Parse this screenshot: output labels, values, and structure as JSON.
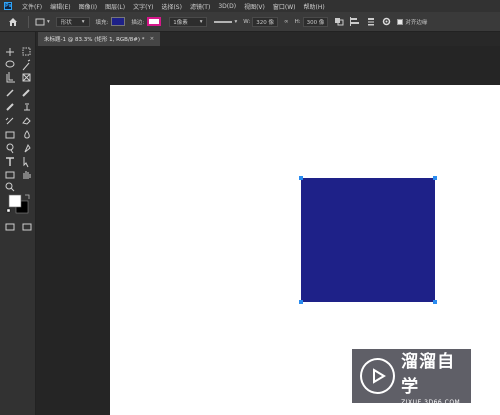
{
  "app": {
    "logo": "Ps"
  },
  "menu": [
    "文件(F)",
    "编辑(E)",
    "图像(I)",
    "图层(L)",
    "文字(Y)",
    "选择(S)",
    "滤镜(T)",
    "3D(D)",
    "视图(V)",
    "窗口(W)",
    "帮助(H)"
  ],
  "options": {
    "mode": "形状",
    "fill_label": "填充:",
    "stroke_label": "描边:",
    "stroke_width": "1像素",
    "w_label": "W:",
    "w_value": "320 像",
    "h_label": "H:",
    "h_value": "300 像",
    "align_edges": "对齐边缘",
    "fill_color": "#1e2188",
    "stroke_color": "#d5188a"
  },
  "document": {
    "tab_title": "未标题-1 @ 83.3% (矩形 1, RGB/8#) *",
    "close_glyph": "×"
  },
  "watermark": {
    "title": "溜溜自学",
    "url": "ZIXUE.3D66.COM"
  }
}
